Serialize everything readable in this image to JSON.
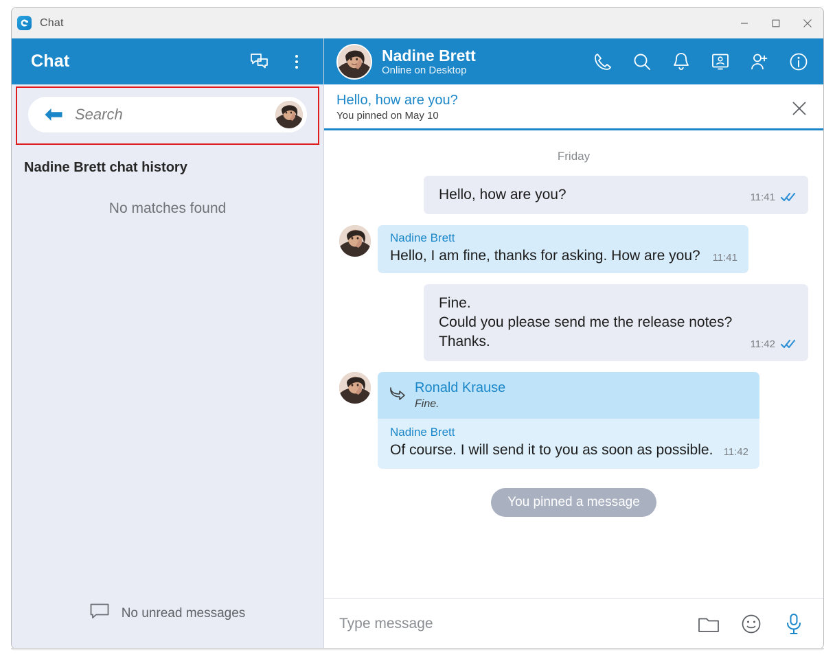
{
  "window": {
    "title": "Chat",
    "app_icon": "chat-app-logo",
    "controls": {
      "minimize": "minimize-icon",
      "maximize": "maximize-icon",
      "close": "close-icon"
    }
  },
  "sidebar": {
    "title": "Chat",
    "header_icons": [
      "new-chat-icon",
      "more-options-icon"
    ],
    "search": {
      "back_icon": "back-arrow-icon",
      "placeholder": "Search",
      "value": "",
      "avatar": "user-avatar",
      "highlighted": true,
      "highlight_color": "#e01b1b"
    },
    "section_title": "Nadine Brett chat history",
    "empty_text": "No matches found",
    "footer": {
      "icon": "message-bubble-icon",
      "text": "No unread messages"
    }
  },
  "chat": {
    "header": {
      "avatar": "contact-avatar",
      "name": "Nadine Brett",
      "status": "Online on Desktop",
      "actions": [
        {
          "name": "call-icon",
          "label": "Call"
        },
        {
          "name": "search-icon",
          "label": "Search"
        },
        {
          "name": "bell-icon",
          "label": "Notifications"
        },
        {
          "name": "screen-share-icon",
          "label": "Share screen"
        },
        {
          "name": "add-person-icon",
          "label": "Add participant"
        },
        {
          "name": "info-icon",
          "label": "Info"
        }
      ]
    },
    "pinned": {
      "title": "Hello, how are you?",
      "subtitle": "You pinned on May 10",
      "close_icon": "close-icon"
    },
    "day_divider": "Friday",
    "messages": [
      {
        "kind": "outgoing",
        "lines": [
          "Hello, how are you?"
        ],
        "time": "11:41",
        "status": "read"
      },
      {
        "kind": "incoming",
        "sender": "Nadine Brett",
        "lines": [
          "Hello, I am fine, thanks for asking. How are you?"
        ],
        "time": "11:41",
        "avatar": "contact-avatar"
      },
      {
        "kind": "outgoing",
        "lines": [
          "Fine.",
          "Could you please send me the release notes?",
          "Thanks."
        ],
        "time": "11:42",
        "status": "read"
      },
      {
        "kind": "quote-group",
        "avatar": "contact-avatar",
        "quote": {
          "icon": "forward-arrow-icon",
          "sender": "Ronald Krause",
          "text": "Fine."
        },
        "reply": {
          "sender": "Nadine Brett",
          "lines": [
            "Of course. I will send it to you as soon as possible."
          ],
          "time": "11:42"
        }
      }
    ],
    "system_pill": "You pinned a message",
    "composer": {
      "placeholder": "Type message",
      "value": "",
      "actions": [
        {
          "name": "attach-folder-icon",
          "label": "Attach file"
        },
        {
          "name": "emoji-icon",
          "label": "Emoji"
        },
        {
          "name": "microphone-icon",
          "label": "Voice message"
        }
      ]
    }
  },
  "colors": {
    "brand_blue": "#1b87c9",
    "sidebar_bg": "#e9ecf4",
    "outgoing_bubble": "#e9ecf4",
    "incoming_bubble": "#d7ecfa",
    "quote_bg": "#bfe4fa",
    "pill_bg": "#a9b0c0",
    "highlight": "#e01b1b"
  }
}
